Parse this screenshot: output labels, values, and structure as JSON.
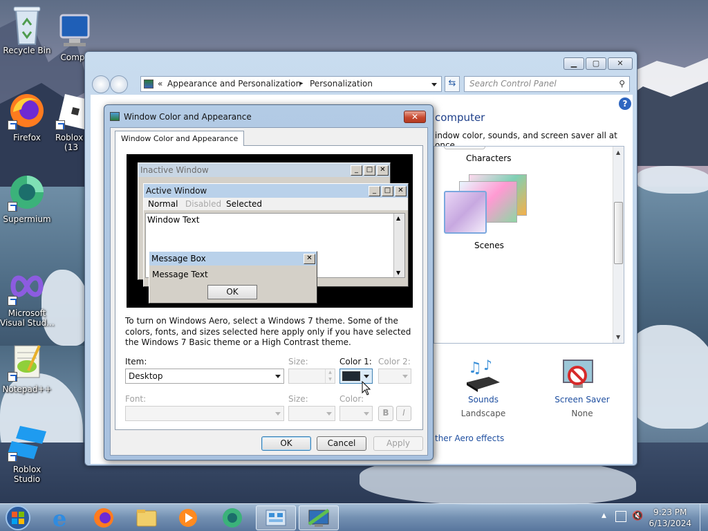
{
  "desktop": {
    "icons": [
      {
        "label": "Recycle Bin"
      },
      {
        "label": "Comp"
      },
      {
        "label": "Firefox"
      },
      {
        "label": "Roblox P\n(13"
      },
      {
        "label": "Supermium"
      },
      {
        "label": "Microsoft\nVisual Stud..."
      },
      {
        "label": "Notepad++"
      },
      {
        "label": "Roblox Studio"
      }
    ]
  },
  "control_panel": {
    "breadcrumb": {
      "chevrons": "«",
      "parent": "Appearance and Personalization",
      "separator": "▸",
      "current": "Personalization"
    },
    "search_placeholder": "Search Control Panel",
    "heading": "computer",
    "subtext": "indow color, sounds, and screen saver all at once.",
    "themes": [
      {
        "label": "Characters"
      },
      {
        "label": "Scenes"
      }
    ],
    "bottom_items": [
      {
        "label": "Sounds",
        "value": "Landscape"
      },
      {
        "label": "Screen Saver",
        "value": "None"
      }
    ],
    "aero_link": "ther Aero effects"
  },
  "dialog": {
    "title": "Window Color and Appearance",
    "tab_label": "Window Color and Appearance",
    "close_glyph": "✕",
    "preview": {
      "inactive_title": "Inactive Window",
      "active_title": "Active Window",
      "menu": {
        "normal": "Normal",
        "disabled": "Disabled",
        "selected": "Selected"
      },
      "window_text": "Window Text",
      "msgbox_title": "Message Box",
      "msgbox_text": "Message Text",
      "msgbox_ok": "OK"
    },
    "info_text": "To turn on Windows Aero, select a Windows 7 theme.  Some of the colors, fonts, and sizes selected here apply only if you have selected the Windows 7 Basic theme or a High Contrast theme.",
    "labels": {
      "item": "Item:",
      "size": "Size:",
      "color1": "Color 1:",
      "color2": "Color 2:",
      "font": "Font:",
      "font_size": "Size:",
      "font_color": "Color:"
    },
    "item_value": "Desktop",
    "color1_hex": "#1f2a33",
    "bold_label": "B",
    "italic_label": "I",
    "buttons": {
      "ok": "OK",
      "cancel": "Cancel",
      "apply": "Apply"
    }
  },
  "taskbar": {
    "time": "9:23 PM",
    "date": "6/13/2024"
  }
}
